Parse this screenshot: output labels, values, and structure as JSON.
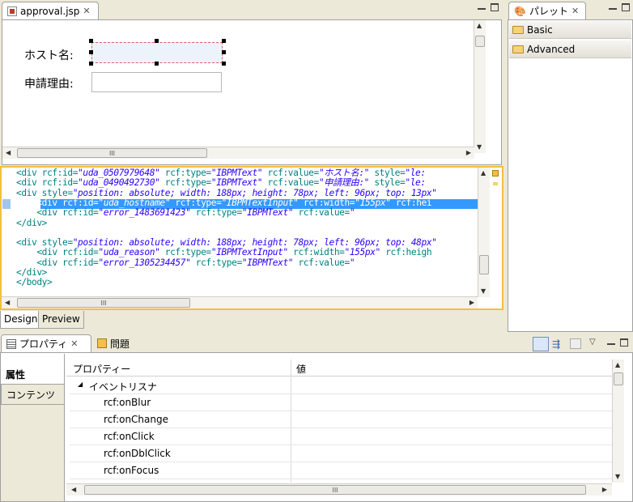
{
  "editor": {
    "tab_label": "approval.jsp",
    "form": {
      "host_label": "ホスト名:",
      "reason_label": "申請理由:"
    },
    "source_lines": [
      {
        "pre": "<div rcf:id=",
        "v1": "\"uda_0507979648\"",
        "m1": " rcf:type=",
        "v2": "\"IBPMText\"",
        "m2": " rcf:value=",
        "v3": "\"ホスト名:\"",
        "m3": " style=",
        "v4": "\"le:"
      },
      {
        "pre": "<div rcf:id=",
        "v1": "\"uda_0490492730\"",
        "m1": " rcf:type=",
        "v2": "\"IBPMText\"",
        "m2": " rcf:value=",
        "v3": "\"申請理由:\"",
        "m3": " style=",
        "v4": "\"le:"
      },
      {
        "pre": "<div style=",
        "v1": "\"position: absolute; width: 188px; height: 78px; left: 96px; top: 13px\"",
        "m1": "",
        "v2": "",
        "m2": "",
        "v3": "",
        "m3": "",
        "v4": ""
      },
      {
        "pre": "    <div rcf:id=",
        "v1": "\"uda_hostname\"",
        "m1": " rcf:type=",
        "v2": "\"IBPMTextInput\"",
        "m2": " rcf:width=",
        "v3": "\"155px\"",
        "m3": " rcf:hei",
        "v4": ""
      },
      {
        "pre": "    <div rcf:id=",
        "v1": "\"error_1483691423\"",
        "m1": " rcf:type=",
        "v2": "\"IBPMText\"",
        "m2": " rcf:value=",
        "v3": "\"",
        "m3": "",
        "v4": ""
      },
      {
        "pre": "</div>",
        "v1": "",
        "m1": "",
        "v2": "",
        "m2": "",
        "v3": "",
        "m3": "",
        "v4": ""
      },
      {
        "pre": "",
        "v1": "",
        "m1": "",
        "v2": "",
        "m2": "",
        "v3": "",
        "m3": "",
        "v4": ""
      },
      {
        "pre": "<div style=",
        "v1": "\"position: absolute; width: 188px; height: 78px; left: 96px; top: 48px\"",
        "m1": "",
        "v2": "",
        "m2": "",
        "v3": "",
        "m3": "",
        "v4": ""
      },
      {
        "pre": "    <div rcf:id=",
        "v1": "\"uda_reason\"",
        "m1": " rcf:type=",
        "v2": "\"IBPMTextInput\"",
        "m2": " rcf:width=",
        "v3": "\"155px\"",
        "m3": " rcf:heigh",
        "v4": ""
      },
      {
        "pre": "    <div rcf:id=",
        "v1": "\"error_1305234457\"",
        "m1": " rcf:type=",
        "v2": "\"IBPMText\"",
        "m2": " rcf:value=",
        "v3": "\"",
        "m3": "",
        "v4": ""
      },
      {
        "pre": "</div>",
        "v1": "",
        "m1": "",
        "v2": "",
        "m2": "",
        "v3": "",
        "m3": "",
        "v4": ""
      },
      {
        "pre": "</body>",
        "v1": "",
        "m1": "",
        "v2": "",
        "m2": "",
        "v3": "",
        "m3": "",
        "v4": ""
      }
    ],
    "bottom_tabs": [
      "Design",
      "Preview"
    ]
  },
  "palette": {
    "tab_label": "パレット",
    "items": [
      "Basic",
      "Advanced"
    ]
  },
  "properties": {
    "tab_label": "プロパティ",
    "problems_tab_label": "問題",
    "side_tabs": [
      "属性",
      "コンテンツ"
    ],
    "columns": [
      "プロパティー",
      "値"
    ],
    "group_label": "イベントリスナ",
    "rows": [
      "rcf:onBlur",
      "rcf:onChange",
      "rcf:onClick",
      "rcf:onDblClick",
      "rcf:onFocus"
    ]
  },
  "scroll_grip": "III",
  "colors": {
    "selection": "#3399ff",
    "tag": "#008080",
    "value": "#2a00ff"
  }
}
